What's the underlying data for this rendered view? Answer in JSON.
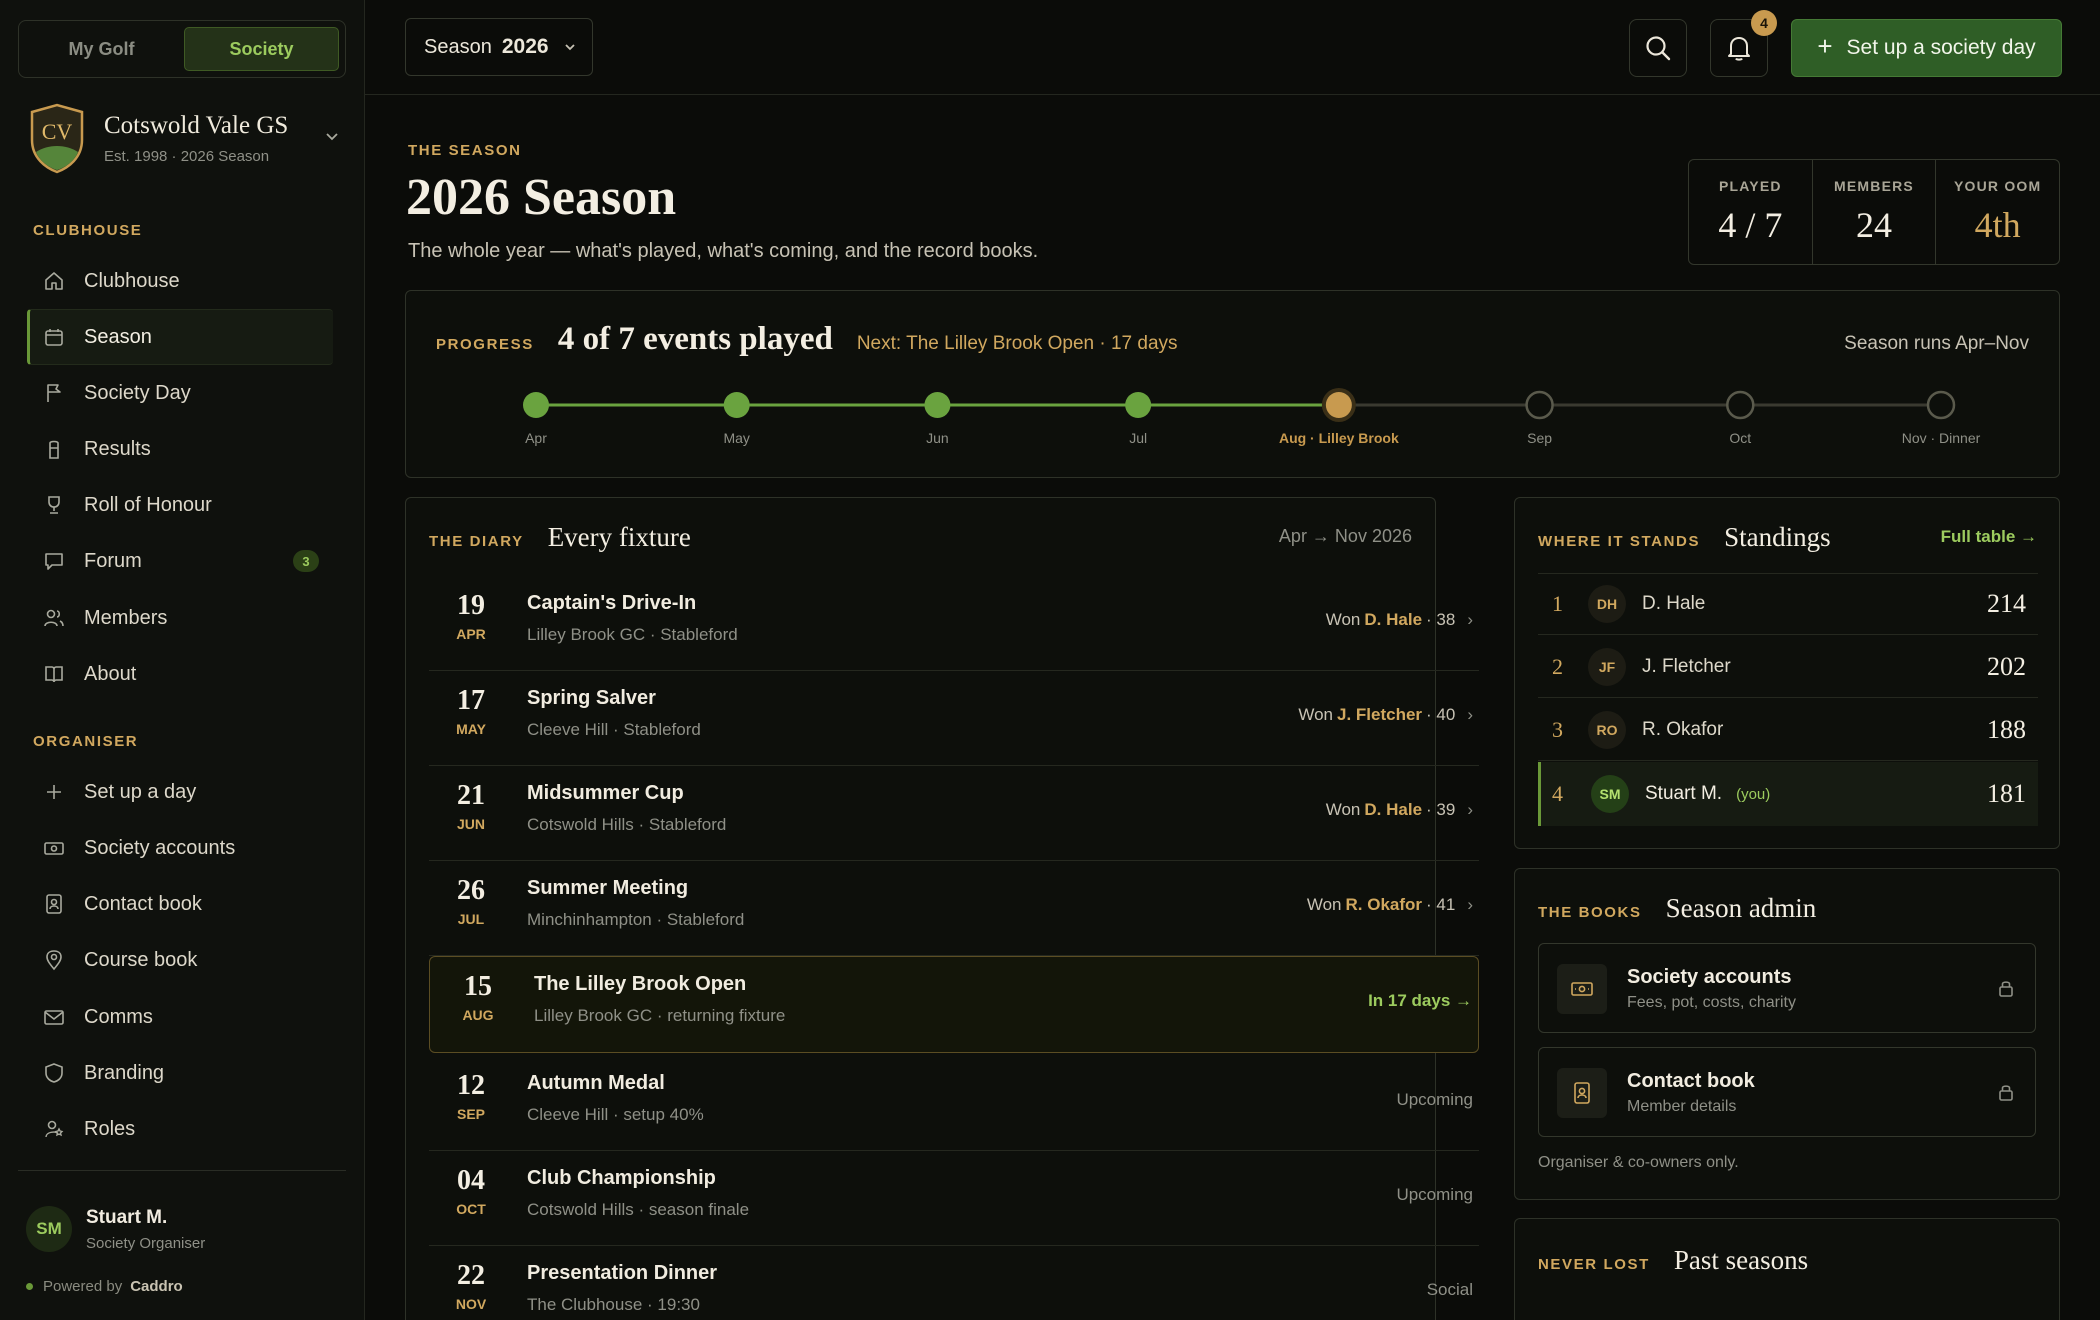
{
  "sidebar": {
    "modes": [
      "My Golf",
      "Society"
    ],
    "club": {
      "name": "Cotswold Vale GS",
      "sub": "Est. 1998 · 2026 Season",
      "crest": "CV"
    },
    "clubhouse_heading": "CLUBHOUSE",
    "clubhouse_items": [
      {
        "label": "Clubhouse",
        "icon": "home-icon"
      },
      {
        "label": "Season",
        "icon": "calendar-icon"
      },
      {
        "label": "Society Day",
        "icon": "flag-icon"
      },
      {
        "label": "Results",
        "icon": "flagstick-icon"
      },
      {
        "label": "Roll of Honour",
        "icon": "trophy-icon"
      },
      {
        "label": "Forum",
        "icon": "chat-icon",
        "badge": "3"
      },
      {
        "label": "Members",
        "icon": "members-icon"
      },
      {
        "label": "About",
        "icon": "book-icon"
      }
    ],
    "organiser_heading": "ORGANISER",
    "organiser_items": [
      {
        "label": "Set up a day",
        "icon": "plus-icon"
      },
      {
        "label": "Society accounts",
        "icon": "banknote-icon"
      },
      {
        "label": "Contact book",
        "icon": "contact-book-icon"
      },
      {
        "label": "Course book",
        "icon": "map-pin-icon"
      },
      {
        "label": "Comms",
        "icon": "mail-icon"
      },
      {
        "label": "Branding",
        "icon": "shield-icon"
      },
      {
        "label": "Roles",
        "icon": "user-roles-icon"
      }
    ],
    "user": {
      "initials": "SM",
      "name": "Stuart M.",
      "role": "Society Organiser"
    },
    "powered_label": "Powered by",
    "powered_brand": "Caddro"
  },
  "topbar": {
    "season_label": "Season",
    "season_year": "2026",
    "notification_count": "4",
    "primary_button": "Set up a society day"
  },
  "header": {
    "eyebrow": "THE SEASON",
    "title": "2026 Season",
    "subtitle": "The whole year — what's played, what's coming, and the record books."
  },
  "stats": [
    {
      "label": "PLAYED",
      "value": "4 / 7"
    },
    {
      "label": "MEMBERS",
      "value": "24"
    },
    {
      "label": "YOUR OOM",
      "value": "4th"
    }
  ],
  "progress": {
    "eyebrow": "PROGRESS",
    "title": "4 of 7 events played",
    "next": "Next: The Lilley Brook Open · 17 days",
    "runs": "Season runs Apr–Nov",
    "played_fraction": 0.5714,
    "colors": {
      "played": "#6aa33f",
      "current": "#c89a4f",
      "upcoming": "#5a5a4c"
    },
    "milestones": [
      {
        "label": "Apr",
        "state": "played"
      },
      {
        "label": "May",
        "state": "played"
      },
      {
        "label": "Jun",
        "state": "played"
      },
      {
        "label": "Jul",
        "state": "played"
      },
      {
        "label": "Aug · Lilley Brook",
        "state": "current"
      },
      {
        "label": "Sep",
        "state": "upcoming"
      },
      {
        "label": "Oct",
        "state": "upcoming"
      },
      {
        "label": "Nov · Dinner",
        "state": "upcoming"
      }
    ]
  },
  "diary": {
    "eyebrow": "THE DIARY",
    "title": "Every fixture",
    "range": "Apr → Nov 2026",
    "fixtures": [
      {
        "day": "19",
        "month": "APR",
        "name": "Captain's Drive-In",
        "meta": "Lilley Brook GC · Stableford",
        "result_prefix": "Won",
        "winner": "D. Hale",
        "score": "· 38",
        "arrow": "›"
      },
      {
        "day": "17",
        "month": "MAY",
        "name": "Spring Salver",
        "meta": "Cleeve Hill · Stableford",
        "result_prefix": "Won",
        "winner": "J. Fletcher",
        "score": "· 40",
        "arrow": "›"
      },
      {
        "day": "21",
        "month": "JUN",
        "name": "Midsummer Cup",
        "meta": "Cotswold Hills · Stableford",
        "result_prefix": "Won",
        "winner": "D. Hale",
        "score": "· 39",
        "arrow": "›"
      },
      {
        "day": "26",
        "month": "JUL",
        "name": "Summer Meeting",
        "meta": "Minchinhampton · Stableford",
        "result_prefix": "Won",
        "winner": "R. Okafor",
        "score": "· 41",
        "arrow": "›"
      },
      {
        "day": "15",
        "month": "AUG",
        "name": "The Lilley Brook Open",
        "meta": "Lilley Brook GC · returning fixture",
        "status": "In 17 days →"
      },
      {
        "day": "12",
        "month": "SEP",
        "name": "Autumn Medal",
        "meta": "Cleeve Hill · setup 40%",
        "status": "Upcoming"
      },
      {
        "day": "04",
        "month": "OCT",
        "name": "Club Championship",
        "meta": "Cotswold Hills · season finale",
        "status": "Upcoming"
      },
      {
        "day": "22",
        "month": "NOV",
        "name": "Presentation Dinner",
        "meta": "The Clubhouse · 19:30",
        "status": "Social"
      }
    ]
  },
  "standings": {
    "eyebrow": "WHERE IT STANDS",
    "title": "Standings",
    "link": "Full table →",
    "rows": [
      {
        "pos": "1",
        "initials": "DH",
        "name": "D. Hale",
        "points": "214"
      },
      {
        "pos": "2",
        "initials": "JF",
        "name": "J. Fletcher",
        "points": "202"
      },
      {
        "pos": "3",
        "initials": "RO",
        "name": "R. Okafor",
        "points": "188"
      },
      {
        "pos": "4",
        "initials": "SM",
        "name": "Stuart M.",
        "you": "(you)",
        "points": "181"
      }
    ]
  },
  "admin": {
    "eyebrow": "THE BOOKS",
    "title": "Season admin",
    "items": [
      {
        "title": "Society accounts",
        "sub": "Fees, pot, costs, charity"
      },
      {
        "title": "Contact book",
        "sub": "Member details"
      }
    ],
    "note": "Organiser & co-owners only."
  },
  "past": {
    "eyebrow": "NEVER LOST",
    "title": "Past seasons"
  }
}
